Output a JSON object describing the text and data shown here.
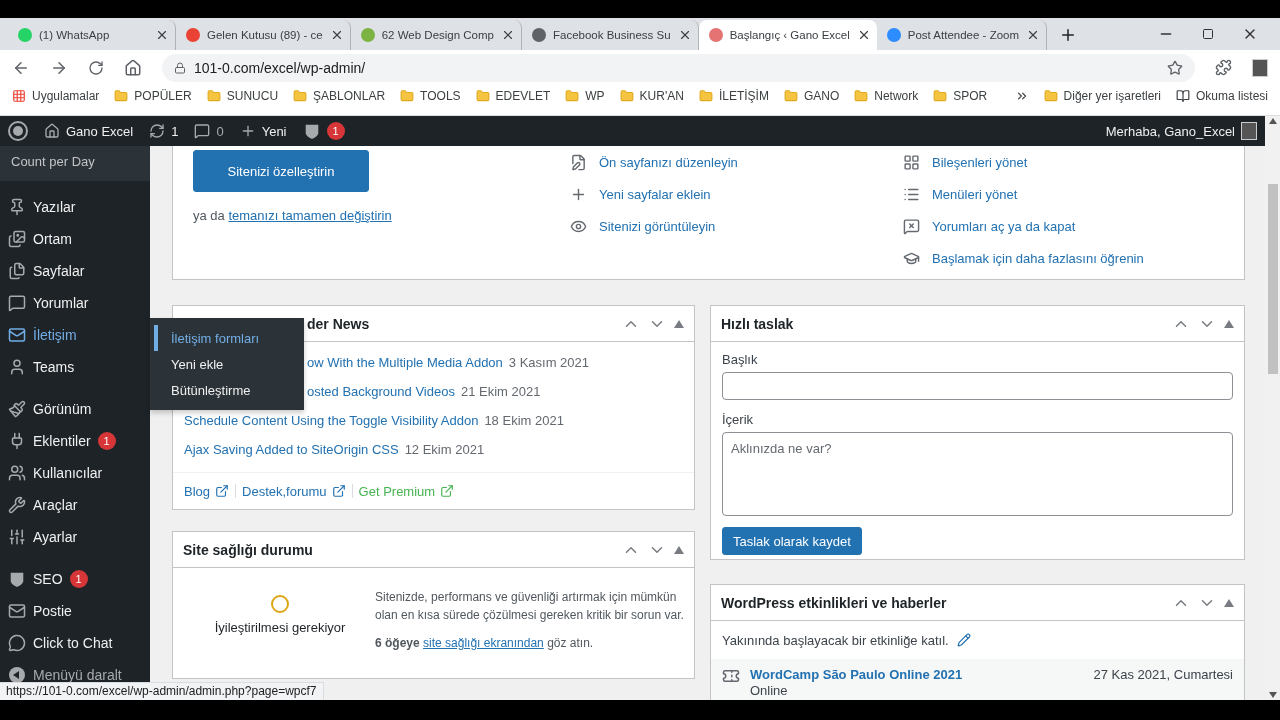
{
  "browser": {
    "tabs": [
      {
        "title": "(1) WhatsApp",
        "selected": false
      },
      {
        "title": "Gelen Kutusu (89) - ce",
        "selected": false
      },
      {
        "title": "62 Web Design Comp",
        "selected": false
      },
      {
        "title": "Facebook Business Su",
        "selected": false
      },
      {
        "title": "Başlangıç ‹ Gano Excel",
        "selected": true
      },
      {
        "title": "Post Attendee - Zoom",
        "selected": false
      }
    ],
    "address": "101-0.com/excel/wp-admin/",
    "bookmarks": {
      "apps": "Uygulamalar",
      "folders": [
        "POPÜLER",
        "SUNUCU",
        "ŞABLONLAR",
        "TOOLS",
        "EDEVLET",
        "WP",
        "KUR'AN",
        "İLETİŞİM",
        "GANO",
        "Network",
        "SPOR"
      ],
      "other": "Diğer yer işaretleri",
      "reading_list": "Okuma listesi"
    },
    "status_url": "https://101-0.com/excel/wp-admin/admin.php?page=wpcf7"
  },
  "admin_bar": {
    "site": "Gano Excel",
    "updates": "1",
    "comments": "0",
    "new": "Yeni",
    "seo_badge": "1",
    "greeting": "Merhaba, Gano_Excel"
  },
  "sidebar": {
    "top_item": "Count per Day",
    "groups": [
      {
        "items": [
          {
            "label": "Yazılar",
            "selected": false
          },
          {
            "label": "Ortam",
            "selected": false
          },
          {
            "label": "Sayfalar",
            "selected": false
          },
          {
            "label": "Yorumlar",
            "selected": false
          },
          {
            "label": "İletişim",
            "selected": true
          },
          {
            "label": "Teams",
            "selected": false
          }
        ]
      },
      {
        "items": [
          {
            "label": "Görünüm",
            "selected": false
          },
          {
            "label": "Eklentiler",
            "selected": false,
            "badge": "1"
          },
          {
            "label": "Kullanıcılar",
            "selected": false
          },
          {
            "label": "Araçlar",
            "selected": false
          },
          {
            "label": "Ayarlar",
            "selected": false
          }
        ]
      },
      {
        "items": [
          {
            "label": "SEO",
            "selected": false,
            "badge": "1"
          },
          {
            "label": "Postie",
            "selected": false
          },
          {
            "label": "Click to Chat",
            "selected": false
          }
        ]
      }
    ],
    "collapse": "Menüyü daralt"
  },
  "submenu": {
    "items": [
      {
        "label": "İletişim formları",
        "selected": true
      },
      {
        "label": "Yeni ekle",
        "selected": false
      },
      {
        "label": "Bütünleştirme",
        "selected": false
      }
    ]
  },
  "welcome": {
    "button": "Sitenizi özelleştirin",
    "alt_prefix": "ya da",
    "alt_link": "temanızı tamamen değiştirin",
    "next_steps": [
      "Ön sayfanızı düzenleyin",
      "Yeni sayfalar eklein",
      "Sitenizi görüntüleyin"
    ],
    "more_actions": [
      "Bileşenleri yönet",
      "Menüleri yönet",
      "Yorumları aç ya da kapat",
      "Başlamak için daha fazlasını öğrenin"
    ]
  },
  "news": {
    "title": "der News",
    "title_covered": true,
    "items": [
      {
        "title": "ow With the Multiple Media Addon",
        "date": "3 Kasım 2021",
        "covered": true
      },
      {
        "title": "osted Background Videos",
        "date": "21 Ekim 2021",
        "covered": true
      },
      {
        "title": "Schedule Content Using the Toggle Visibility Addon",
        "date": "18 Ekim 2021",
        "covered": false
      },
      {
        "title": "Ajax Saving Added to SiteOrigin CSS",
        "date": "12 Ekim 2021",
        "covered": false
      }
    ],
    "links": [
      {
        "label": "Blog",
        "color": "#2271b1"
      },
      {
        "label": "Destek,forumu",
        "color": "#2271b1"
      },
      {
        "label": "Get Premium",
        "color": "#46b450"
      }
    ]
  },
  "site_health": {
    "title": "Site sağlığı durumu",
    "status": "İyileştirilmesi gerekiyor",
    "message": "Sitenizde, performans ve güvenliği artırmak için mümkün olan en kısa sürede çözülmesi gereken kritik bir sorun var.",
    "count": "6 öğeye",
    "link": "site sağlığı ekranından",
    "suffix": "göz atın."
  },
  "quick_draft": {
    "title": "Hızlı taslak",
    "title_label": "Başlık",
    "content_label": "İçerik",
    "content_field": {
      "placeholder": "Aklınızda ne var?"
    },
    "button": "Taslak olarak kaydet"
  },
  "events": {
    "title": "WordPress etkinlikleri ve haberler",
    "intro": "Yakınında başlayacak bir etkinliğe katıl.",
    "event": {
      "title": "WordCamp São Paulo Online 2021",
      "date": "27 Kas 2021, Cumartesi",
      "location": "Online"
    }
  }
}
